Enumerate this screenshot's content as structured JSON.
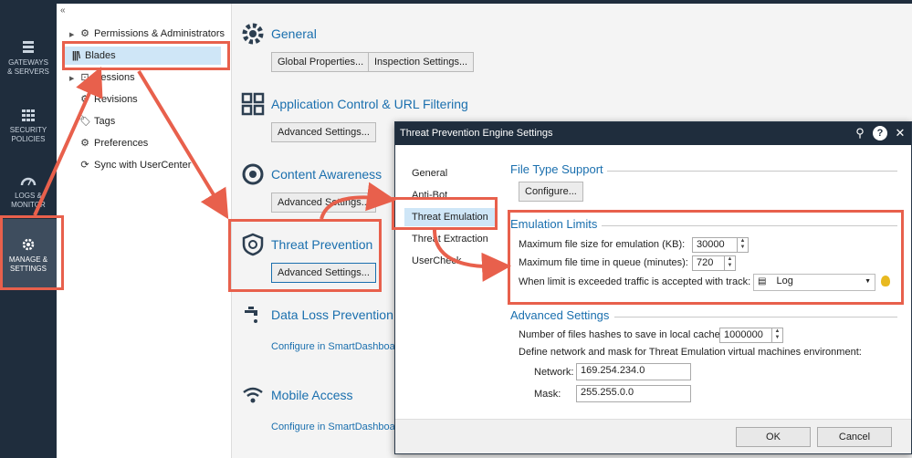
{
  "leftnav": {
    "items": [
      {
        "label": "GATEWAYS\n& SERVERS",
        "icon": "gateway-icon"
      },
      {
        "label": "SECURITY\nPOLICIES",
        "icon": "grid-icon"
      },
      {
        "label": "LOGS &\nMONITOR",
        "icon": "gauge-icon"
      },
      {
        "label": "MANAGE &\nSETTINGS",
        "icon": "gear-icon"
      }
    ]
  },
  "tree": {
    "collapse": "«",
    "items": [
      {
        "label": "Permissions & Administrators",
        "icon": "gear-icon"
      },
      {
        "label": "Blades",
        "icon": "blades-icon"
      },
      {
        "label": "Sessions",
        "icon": "sessions-icon"
      },
      {
        "label": "Revisions",
        "icon": "gear-icon"
      },
      {
        "label": "Tags",
        "icon": "tag-icon"
      },
      {
        "label": "Preferences",
        "icon": "gear-icon"
      },
      {
        "label": "Sync with UserCenter",
        "icon": "sync-icon"
      }
    ]
  },
  "main": {
    "general": {
      "title": "General",
      "btn1": "Global Properties...",
      "btn2": "Inspection Settings..."
    },
    "appcontrol": {
      "title": "Application Control & URL Filtering",
      "btn": "Advanced Settings..."
    },
    "content": {
      "title": "Content Awareness",
      "btn": "Advanced Settings..."
    },
    "threat": {
      "title": "Threat Prevention",
      "btn": "Advanced Settings..."
    },
    "dlp": {
      "title": "Data Loss Prevention",
      "link": "Configure in SmartDashboard"
    },
    "mobile": {
      "title": "Mobile Access",
      "link": "Configure in SmartDashboard"
    }
  },
  "dialog": {
    "title": "Threat Prevention Engine Settings",
    "nav": [
      "General",
      "Anti-Bot",
      "Threat Emulation",
      "Threat Extraction",
      "UserCheck"
    ],
    "filetype": {
      "title": "File Type Support",
      "btn": "Configure..."
    },
    "limits": {
      "title": "Emulation Limits",
      "max_size_label": "Maximum file size for emulation (KB):",
      "max_size_value": "30000",
      "max_time_label": "Maximum file time in queue (minutes):",
      "max_time_value": "720",
      "exceed_label": "When limit is exceeded traffic is  accepted  with track:",
      "track_value": "Log"
    },
    "advanced": {
      "title": "Advanced Settings",
      "hashes_label": "Number of files hashes to save in local cache:",
      "hashes_value": "1000000",
      "network_desc": "Define network and mask for Threat Emulation virtual machines environment:",
      "network_label": "Network:",
      "network_value": "169.254.234.0",
      "mask_label": "Mask:",
      "mask_value": "255.255.0.0"
    },
    "ok": "OK",
    "cancel": "Cancel"
  },
  "colors": {
    "accent": "#1a6fae",
    "highlight": "#e8604c",
    "nav_bg": "#1f2d3d"
  }
}
